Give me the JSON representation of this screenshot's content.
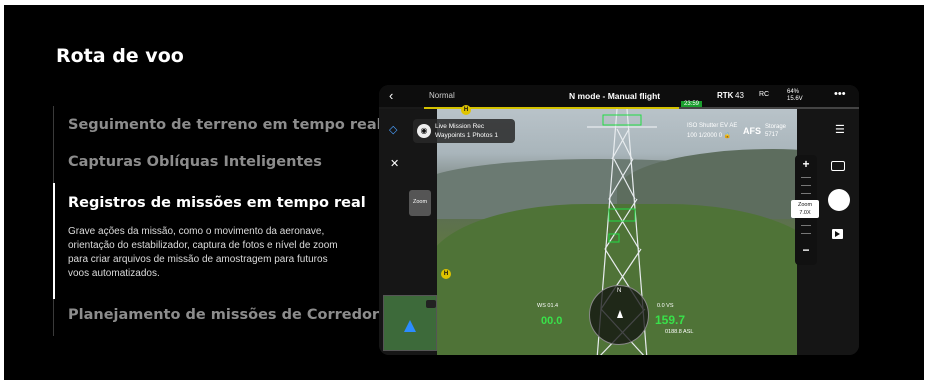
{
  "section": {
    "title": "Rota de voo"
  },
  "menu": {
    "items": [
      {
        "label": "Seguimento de terreno em tempo real"
      },
      {
        "label": "Capturas Oblíquas Inteligentes"
      },
      {
        "label": "Registros de missões em tempo real"
      },
      {
        "label": "Planejamento de missões de Corredor"
      }
    ],
    "active_description": "Grave ações da missão, como o movimento da aeronave, orientação do estabilizador, captura de fotos e nível de zoom para criar arquivos de missão de amostragem para futuros voos automatizados."
  },
  "device": {
    "topbar": {
      "back_icon": "‹",
      "normal": "Normal",
      "mode": "N mode - Manual flight",
      "rtk": "RTK",
      "signal": "43",
      "rc": "RC",
      "battery_pct": "64%",
      "battery_v": "15.6V",
      "more_icon": "•••",
      "time": "23:59"
    },
    "mission": {
      "line1": "Live Mission Rec",
      "line2": "Waypoints 1  Photos 1"
    },
    "camera_params": {
      "labels": "ISO   Shutter   EV   AE",
      "values": "100  1/2000    0   🔒",
      "afs": "AFS",
      "storage_label": "Storage",
      "storage_value": "5717"
    },
    "zoom": {
      "plus": "+",
      "minus": "−",
      "label": "Zoom",
      "value": "7.0X",
      "button": "Zoom"
    },
    "hud": {
      "left_top": "WS 01.4",
      "left_value": "00.0",
      "right_top": "0.0 VS",
      "right_value": "159.7",
      "asl": "0188.8 ASL",
      "compass_n": "N"
    },
    "markers": [
      "H",
      "H"
    ]
  },
  "colors": {
    "background": "#000000",
    "active_text": "#ffffff",
    "inactive_text": "#8c8c8c",
    "hud_green": "#39e14a",
    "progress_yellow": "#d4c200"
  }
}
